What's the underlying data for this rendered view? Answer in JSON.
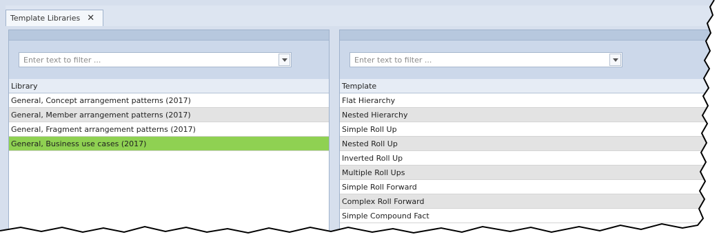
{
  "tab": {
    "label": "Template Libraries",
    "close_glyph": "✕"
  },
  "left_panel": {
    "filter_placeholder": "Enter text to filter ...",
    "column_header": "Library",
    "rows": [
      {
        "label": "General, Concept arrangement patterns (2017)"
      },
      {
        "label": "General, Member arrangement patterns (2017)"
      },
      {
        "label": "General, Fragment arrangement patterns (2017)"
      },
      {
        "label": "General, Business use cases (2017)"
      }
    ],
    "selected_index": 3
  },
  "right_panel": {
    "filter_placeholder": "Enter text to filter ...",
    "column_header": "Template",
    "rows": [
      {
        "label": "Flat Hierarchy"
      },
      {
        "label": "Nested Hierarchy"
      },
      {
        "label": "Simple Roll Up"
      },
      {
        "label": "Nested Roll Up"
      },
      {
        "label": "Inverted Roll Up"
      },
      {
        "label": "Multiple Roll Ups"
      },
      {
        "label": "Simple Roll Forward"
      },
      {
        "label": "Complex Roll Forward"
      },
      {
        "label": "Simple Compound Fact"
      }
    ]
  },
  "colors": {
    "selected_row": "#8fd152",
    "alt_row": "#e3e3e3",
    "header_bg": "#e6ecf5"
  },
  "icons": {
    "dropdown": "chevron-down-icon",
    "close": "close-icon"
  }
}
